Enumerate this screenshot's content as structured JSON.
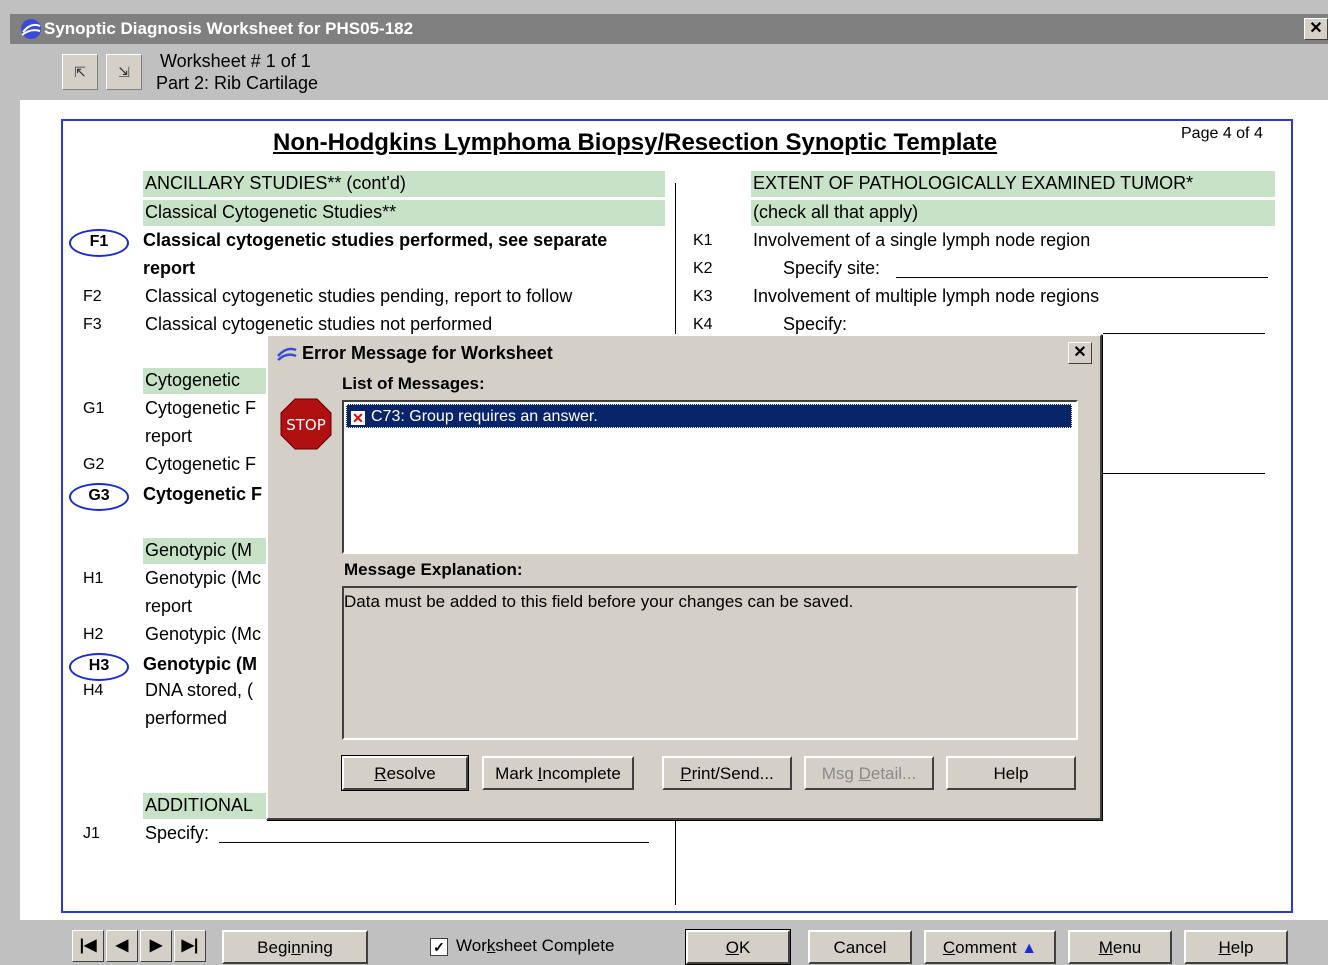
{
  "window": {
    "title": "Synoptic Diagnosis Worksheet for PHS05-182",
    "close": "✕"
  },
  "header": {
    "nav_prev": "⇱",
    "nav_next": "⇲",
    "worksheet_line": "Worksheet # 1 of 1",
    "part_line": "Part 2: Rib Cartilage"
  },
  "sheet": {
    "title": "Non-Hodgkins Lymphoma Biopsy/Resection Synoptic Template",
    "page": "Page 4 of 4",
    "left": {
      "section1": "ANCILLARY STUDIES**  (cont'd)",
      "section1_sub": "Classical Cytogenetic Studies**",
      "F1_code": "F1",
      "F1_text": "Classical cytogenetic studies performed, see separate",
      "F1_text2": "report",
      "F2_code": "F2",
      "F2_text": "Classical cytogenetic studies pending, report to follow",
      "F3_code": "F3",
      "F3_text": "Classical cytogenetic studies not performed",
      "section2": "Cytogenetic",
      "G1_code": "G1",
      "G1_text": "Cytogenetic F",
      "G1_text2": "report",
      "G2_code": "G2",
      "G2_text": "Cytogenetic F",
      "G3_code": "G3",
      "G3_text": "Cytogenetic F",
      "section3": "Genotypic (M",
      "H1_code": "H1",
      "H1_text": "Genotypic (Mc",
      "H1_text2": "report",
      "H2_code": "H2",
      "H2_text": "Genotypic (Mc",
      "H3_code": "H3",
      "H3_text": "Genotypic (M",
      "H4_code": "H4",
      "H4_text": "DNA stored, (",
      "H4_text2": "performed",
      "section4": "ADDITIONAL",
      "J1_code": "J1",
      "J1_text": "Specify:"
    },
    "right": {
      "section": "EXTENT OF PATHOLOGICALLY EXAMINED TUMOR*",
      "section_sub": "(check all that apply)",
      "K1_code": "K1",
      "K1_text": "Involvement of a single lymph node region",
      "K2_code": "K2",
      "K2_text": "Specify site:",
      "K3_code": "K3",
      "K3_text": "Involvement of multiple lymph node regions",
      "K4_code": "K4",
      "K4_text": "Specify:"
    }
  },
  "dialog": {
    "title": "Error Message for Worksheet",
    "close": "✕",
    "stop_label": "STOP",
    "list_label": "List of Messages:",
    "messages": [
      "C73: Group requires an answer."
    ],
    "explanation_label": "Message Explanation:",
    "explanation": "Data must be added to this field before your changes can be saved.",
    "buttons": {
      "resolve": "Resolve",
      "mark_incomplete": "Mark Incomplete",
      "print_send": "Print/Send...",
      "msg_detail": "Msg Detail...",
      "help": "Help"
    }
  },
  "bottombar": {
    "first": "|◀",
    "prev": "◀",
    "next": "▶",
    "last": "▶|",
    "beginning": "Beginning",
    "worksheet_complete": "Worksheet Complete",
    "worksheet_complete_checked": "✓",
    "ok": "OK",
    "cancel": "Cancel",
    "comment": "Comment",
    "menu": "Menu",
    "help": "Help"
  },
  "colors": {
    "accent_blue": "#2a3ad0",
    "section_green": "#c8e2c8",
    "selection_navy": "#0a246a",
    "stop_red": "#b01010"
  }
}
